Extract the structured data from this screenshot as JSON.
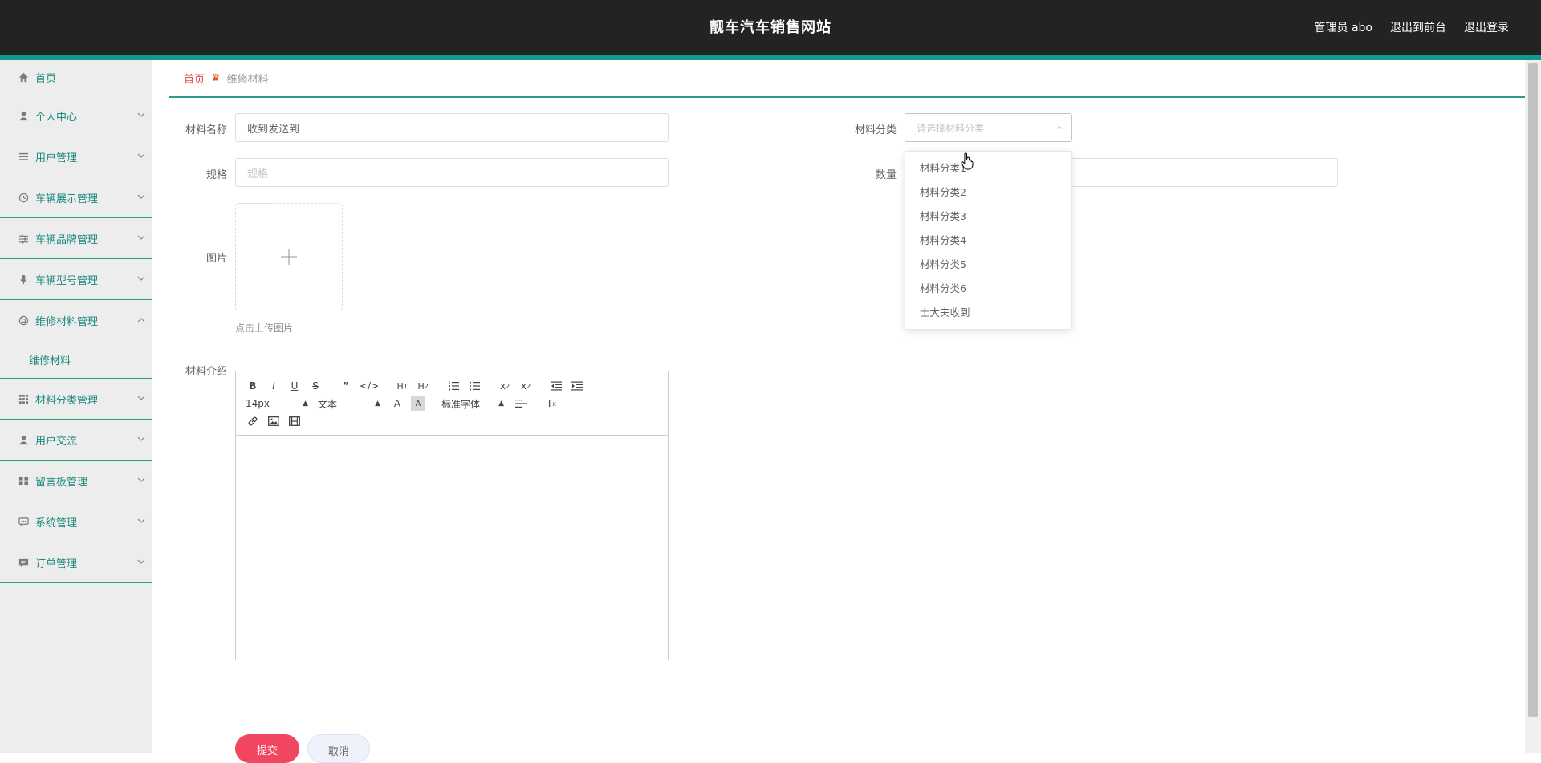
{
  "header": {
    "title": "靓车汽车销售网站",
    "admin_label": "管理员 abo",
    "back_to_front": "退出到前台",
    "logout": "退出登录"
  },
  "sidebar": {
    "items": [
      {
        "label": "首页",
        "icon": "home-icon"
      },
      {
        "label": "个人中心",
        "icon": "user-icon"
      },
      {
        "label": "用户管理",
        "icon": "list-icon"
      },
      {
        "label": "车辆展示管理",
        "icon": "clock-icon"
      },
      {
        "label": "车辆品牌管理",
        "icon": "sliders-icon"
      },
      {
        "label": "车辆型号管理",
        "icon": "mic-icon"
      },
      {
        "label": "维修材料管理",
        "icon": "lifebuoy-icon"
      },
      {
        "label": "材料分类管理",
        "icon": "grid-icon"
      },
      {
        "label": "用户交流",
        "icon": "user-icon"
      },
      {
        "label": "留言板管理",
        "icon": "apps-icon"
      },
      {
        "label": "系统管理",
        "icon": "chat-icon"
      },
      {
        "label": "订单管理",
        "icon": "comment-icon"
      }
    ],
    "submenu": {
      "label": "维修材料"
    }
  },
  "breadcrumb": {
    "home": "首页",
    "current": "维修材料"
  },
  "form": {
    "name_label": "材料名称",
    "name_value": "收到发送到",
    "spec_label": "规格",
    "spec_placeholder": "规格",
    "image_label": "图片",
    "upload_tip": "点击上传图片",
    "intro_label": "材料介绍",
    "category_label": "材料分类",
    "category_placeholder": "请选择材料分类",
    "quantity_label": "数量"
  },
  "dropdown": {
    "options": [
      "材料分类1",
      "材料分类2",
      "材料分类3",
      "材料分类4",
      "材料分类5",
      "材料分类6",
      "士大夫收到"
    ]
  },
  "editor": {
    "size_value": "14px",
    "header_value": "文本",
    "font_value": "标准字体"
  },
  "buttons": {
    "submit": "提交",
    "cancel": "取消"
  }
}
